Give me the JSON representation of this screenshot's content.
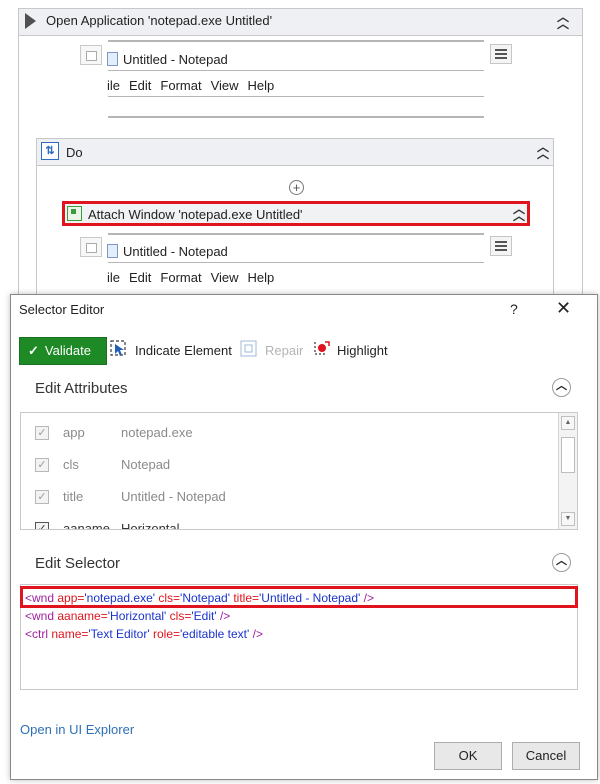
{
  "workflow": {
    "open_app_title": "Open Application 'notepad.exe Untitled'",
    "preview1": {
      "window_title": "Untitled - Notepad",
      "menu": [
        "ile",
        "Edit",
        "Format",
        "View",
        "Help"
      ]
    },
    "do_title": "Do",
    "attach_title": "Attach Window 'notepad.exe Untitled'",
    "preview2": {
      "window_title": "Untitled - Notepad",
      "menu": [
        "ile",
        "Edit",
        "Format",
        "View",
        "Help"
      ]
    }
  },
  "dialog": {
    "title": "Selector Editor",
    "help": "?",
    "close": "✕",
    "toolbar": {
      "validate": "Validate",
      "indicate": "Indicate Element",
      "repair": "Repair",
      "highlight": "Highlight"
    },
    "edit_attributes": {
      "heading": "Edit Attributes",
      "rows": [
        {
          "name": "app",
          "value": "notepad.exe"
        },
        {
          "name": "cls",
          "value": "Notepad"
        },
        {
          "name": "title",
          "value": "Untitled - Notepad"
        },
        {
          "name": "aaname",
          "value": "Horizontal"
        }
      ]
    },
    "edit_selector": {
      "heading": "Edit Selector",
      "line1": {
        "open": "<wnd ",
        "a1": "app=",
        "v1": "'notepad.exe'",
        "a2": " cls=",
        "v2": "'Notepad'",
        "a3": " title=",
        "v3": "'Untitled - Notepad'",
        "close": " />"
      },
      "line2": {
        "open": "<wnd ",
        "a1": "aaname=",
        "v1": "'Horizontal'",
        "a2": " cls=",
        "v2": "'Edit'",
        "close": " />"
      },
      "line3": {
        "open": "<ctrl ",
        "a1": "name=",
        "v1": "'Text Editor'",
        "a2": " role=",
        "v2": "'editable text'",
        "close": " />"
      }
    },
    "open_in_explorer": "Open in UI Explorer",
    "ok": "OK",
    "cancel": "Cancel"
  },
  "colors": {
    "validate_green": "#1e8a26",
    "highlight_red": "#e0141e",
    "selector_tag": "#a020a0",
    "selector_attr": "#e0141e",
    "selector_value": "#1a33cc",
    "link_blue": "#2e6fb6"
  }
}
